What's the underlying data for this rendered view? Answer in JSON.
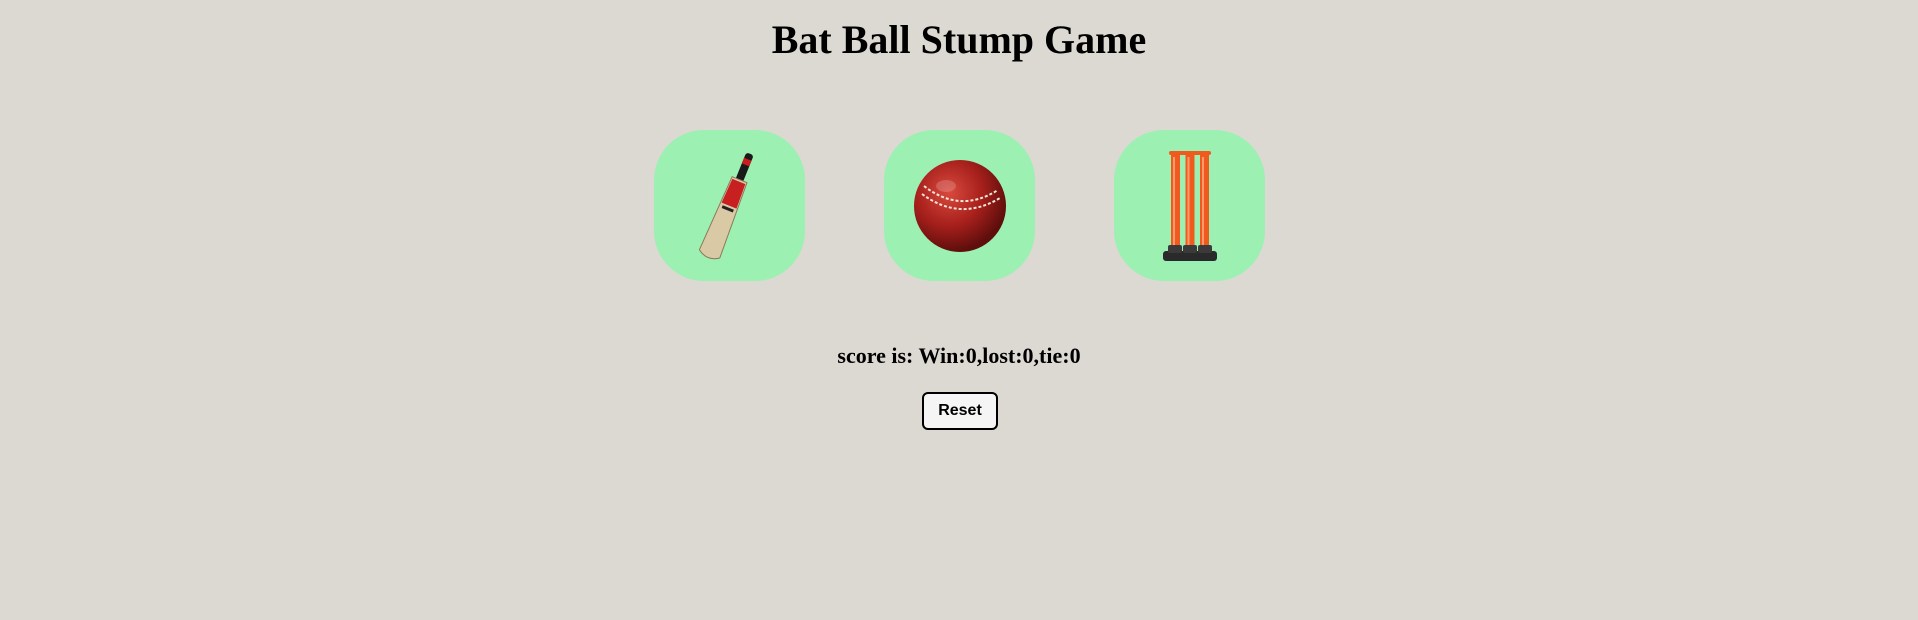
{
  "title": "Bat Ball Stump Game",
  "choices": [
    {
      "name": "Bat",
      "icon": "cricket-bat-icon"
    },
    {
      "name": "Ball",
      "icon": "cricket-ball-icon"
    },
    {
      "name": "Stump",
      "icon": "cricket-stumps-icon"
    }
  ],
  "score": {
    "text": "score is: Win:0,lost:0,tie:0",
    "win": 0,
    "lost": 0,
    "tie": 0
  },
  "reset_label": "Reset",
  "colors": {
    "background": "#dcd9d2",
    "choice_bg": "#9cf0b2",
    "ball_red": "#a8201c",
    "stump_orange": "#f05a1e"
  }
}
